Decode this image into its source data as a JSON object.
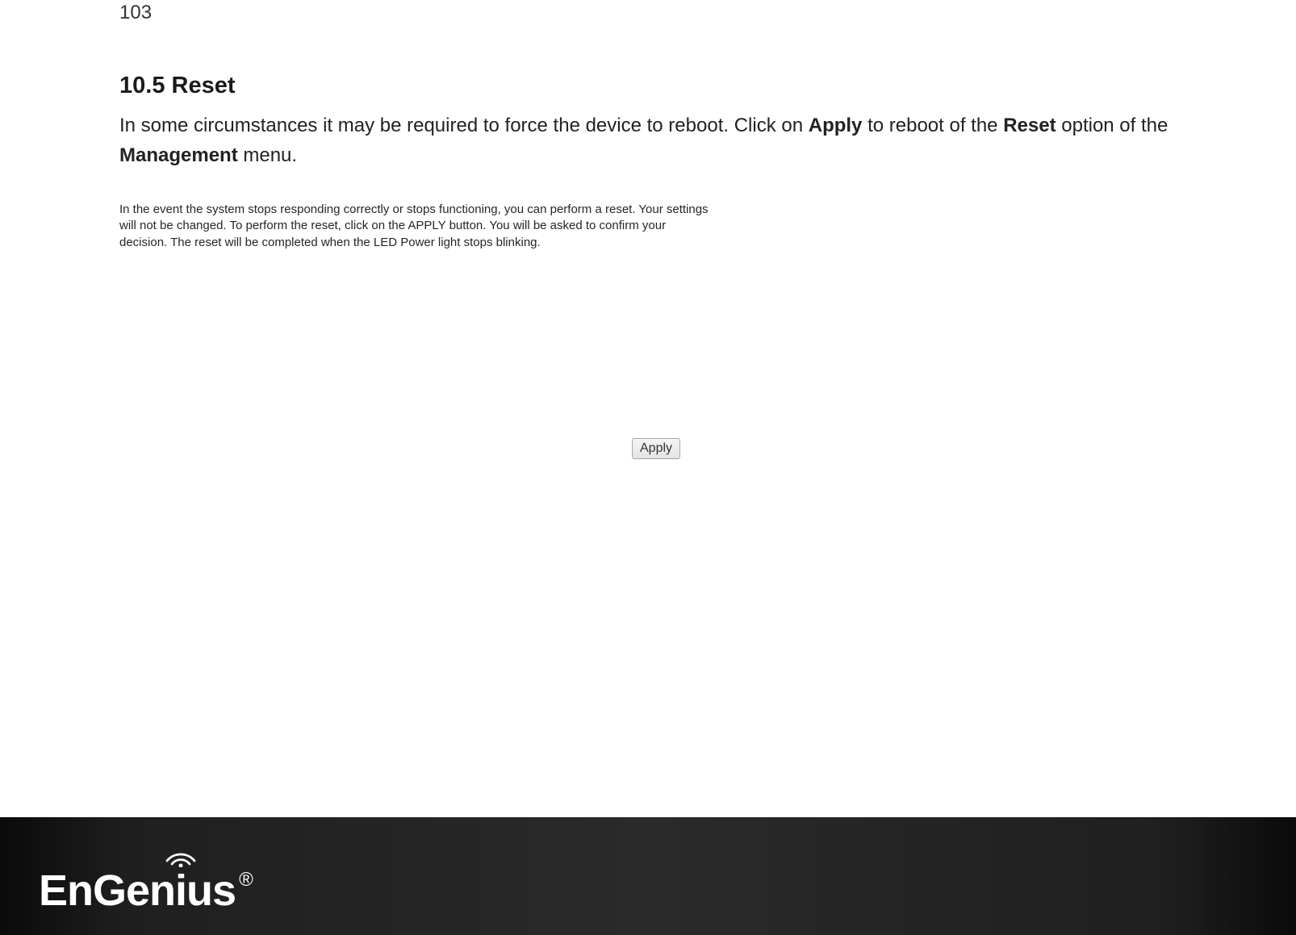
{
  "page_number": "103",
  "section": {
    "heading": "10.5 Reset",
    "intro_pre": "In some circumstances it may be required to force the device to reboot. Click on ",
    "intro_bold1": "Apply",
    "intro_mid1": " to reboot of the ",
    "intro_bold2": "Reset",
    "intro_mid2": " option of the ",
    "intro_bold3": "Management",
    "intro_end": " menu."
  },
  "screenshot": {
    "description": "In the event the system stops responding correctly or stops functioning, you can perform a reset. Your settings will not be changed. To perform the reset, click on the APPLY button. You will be asked to confirm your decision. The reset will be completed when the LED Power light stops blinking.",
    "apply_button_label": "Apply"
  },
  "footer": {
    "brand": "EnGenius",
    "registered_symbol": "®"
  }
}
